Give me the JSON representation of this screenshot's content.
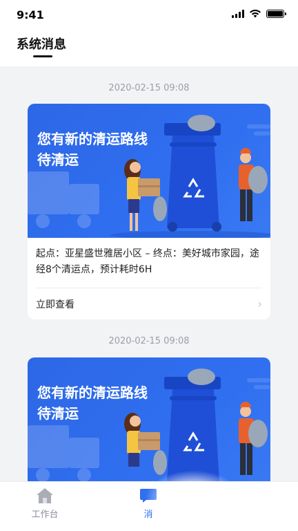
{
  "status_bar": {
    "time": "9:41"
  },
  "header": {
    "title": "系统消息"
  },
  "messages": [
    {
      "timestamp": "2020-02-15 09:08",
      "banner_title": "您有新的清运路线\n待清运",
      "route": "起点：亚星盛世雅居小区 – 终点：美好城市家园，途经8个清运点，预计耗时6H",
      "cta": "立即查看"
    },
    {
      "timestamp": "2020-02-15 09:08",
      "banner_title": "您有新的清运路线\n待清运",
      "route": "",
      "cta": ""
    }
  ],
  "tabbar": {
    "items": [
      {
        "label": "工作台",
        "icon": "home-icon"
      },
      {
        "label": "消",
        "icon": "message-icon"
      }
    ]
  },
  "colors": {
    "accent": "#2f6ff0",
    "banner": "#2d67e6",
    "recycle_bin": "#1f4fd6"
  }
}
